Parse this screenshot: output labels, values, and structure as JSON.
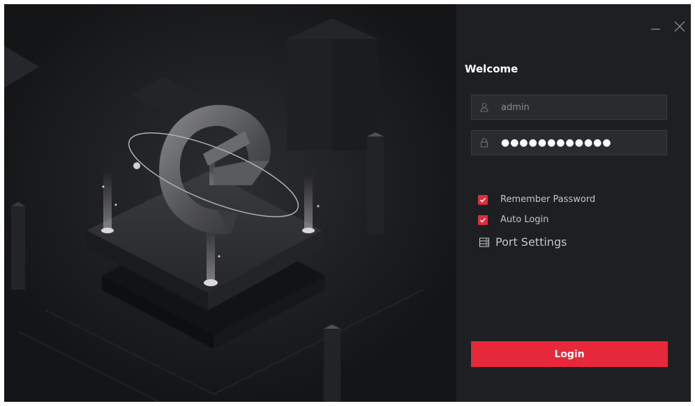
{
  "window": {
    "controls": {
      "minimize_icon": "minimize-icon",
      "close_icon": "close-icon"
    }
  },
  "login": {
    "welcome": "Welcome",
    "username": {
      "value": "admin",
      "icon": "user-icon"
    },
    "password": {
      "value": "●●●●●●●●●●●●",
      "icon": "lock-icon"
    },
    "remember_password": {
      "label": "Remember Password",
      "checked": true
    },
    "auto_login": {
      "label": "Auto Login",
      "checked": true
    },
    "port_settings": {
      "label": "Port Settings",
      "icon": "server-icon"
    },
    "login_button": "Login"
  },
  "colors": {
    "accent": "#e6283a",
    "panel_bg": "#1e1f22",
    "field_bg": "#2a2b2e",
    "art_bg": "#18191b"
  }
}
